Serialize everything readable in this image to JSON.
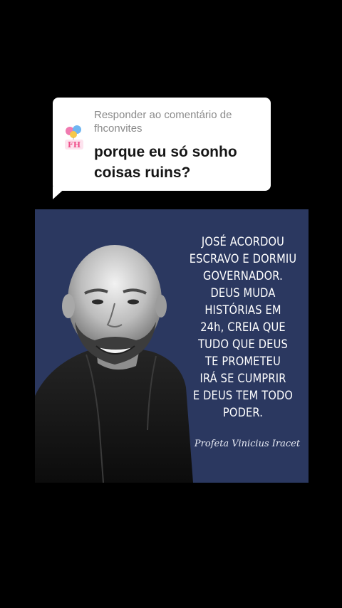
{
  "reply": {
    "header": "Responder ao comentário de fhconvites",
    "comment": "porque eu só sonho coisas ruins?",
    "avatar_text": "FH",
    "avatar_colors": {
      "balloon_pink": "#f07ab0",
      "balloon_blue": "#6fb6f2",
      "text": "#ef4f8a"
    }
  },
  "quote_card": {
    "background": "#2b3860",
    "lines": [
      "JOSÉ ACORDOU",
      "ESCRAVO E DORMIU",
      "GOVERNADOR.",
      "DEUS MUDA",
      "HISTÓRIAS EM",
      "24h, CREIA QUE",
      "TUDO QUE DEUS",
      "TE PROMETEU",
      "IRÁ SE CUMPRIR",
      "E DEUS TEM TODO",
      "PODER."
    ],
    "signature": "Profeta Vinicius Iracet"
  }
}
